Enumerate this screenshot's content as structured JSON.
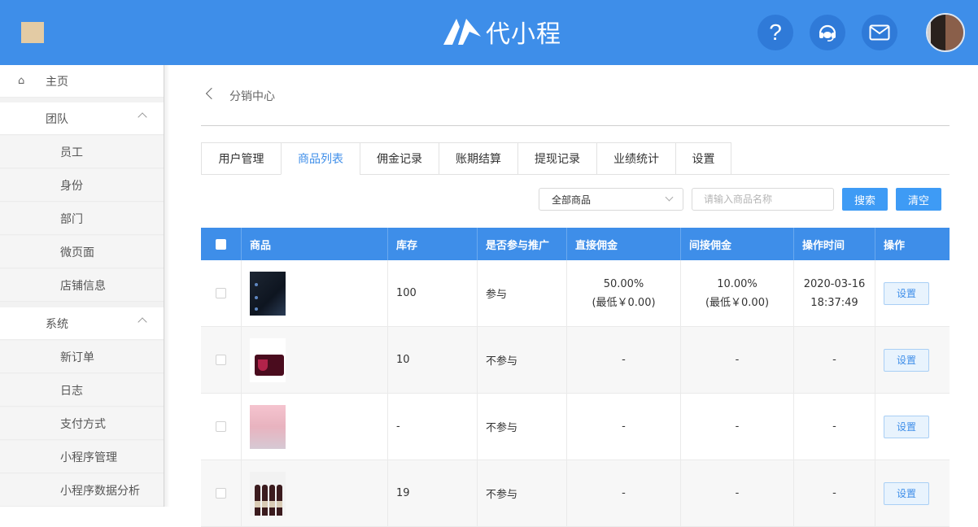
{
  "header": {
    "logo_text": "代小程",
    "help_glyph": "?"
  },
  "sidebar": {
    "items": [
      {
        "label": "主页",
        "kind": "home"
      },
      {
        "label": "团队",
        "kind": "group"
      },
      {
        "label": "员工",
        "kind": "sub"
      },
      {
        "label": "身份",
        "kind": "sub"
      },
      {
        "label": "部门",
        "kind": "sub"
      },
      {
        "label": "微页面",
        "kind": "sub"
      },
      {
        "label": "店铺信息",
        "kind": "sub"
      },
      {
        "label": "系统",
        "kind": "group"
      },
      {
        "label": "新订单",
        "kind": "sub"
      },
      {
        "label": "日志",
        "kind": "sub"
      },
      {
        "label": "支付方式",
        "kind": "sub"
      },
      {
        "label": "小程序管理",
        "kind": "sub"
      },
      {
        "label": "小程序数据分析",
        "kind": "sub"
      }
    ]
  },
  "breadcrumb": "分销中心",
  "tabs": [
    {
      "label": "用户管理",
      "active": false
    },
    {
      "label": "商品列表",
      "active": true
    },
    {
      "label": "佣金记录",
      "active": false
    },
    {
      "label": "账期结算",
      "active": false
    },
    {
      "label": "提现记录",
      "active": false
    },
    {
      "label": "业绩统计",
      "active": false
    },
    {
      "label": "设置",
      "active": false
    }
  ],
  "filter": {
    "select_value": "全部商品",
    "search_placeholder": "请输入商品名称",
    "search_button": "搜索",
    "clear_button": "清空"
  },
  "table": {
    "columns": [
      "商品",
      "库存",
      "是否参与推广",
      "直接佣金",
      "间接佣金",
      "操作时间",
      "操作"
    ],
    "rows": [
      {
        "stock": "100",
        "promo": "参与",
        "direct": "50.00%",
        "direct_min": "(最低￥0.00)",
        "indirect": "10.00%",
        "indirect_min": "(最低￥0.00)",
        "date": "2020-03-16",
        "time": "18:37:49",
        "action": "设置"
      },
      {
        "stock": "10",
        "promo": "不参与",
        "direct": "-",
        "direct_min": "",
        "indirect": "-",
        "indirect_min": "",
        "date": "-",
        "time": "",
        "action": "设置"
      },
      {
        "stock": "-",
        "promo": "不参与",
        "direct": "-",
        "direct_min": "",
        "indirect": "-",
        "indirect_min": "",
        "date": "-",
        "time": "",
        "action": "设置"
      },
      {
        "stock": "19",
        "promo": "不参与",
        "direct": "-",
        "direct_min": "",
        "indirect": "-",
        "indirect_min": "",
        "date": "-",
        "time": "",
        "action": "设置"
      }
    ]
  },
  "colors": {
    "primary": "#3e8ee9",
    "button": "#3e9bf5",
    "header_bg": "#3e8ee9"
  }
}
